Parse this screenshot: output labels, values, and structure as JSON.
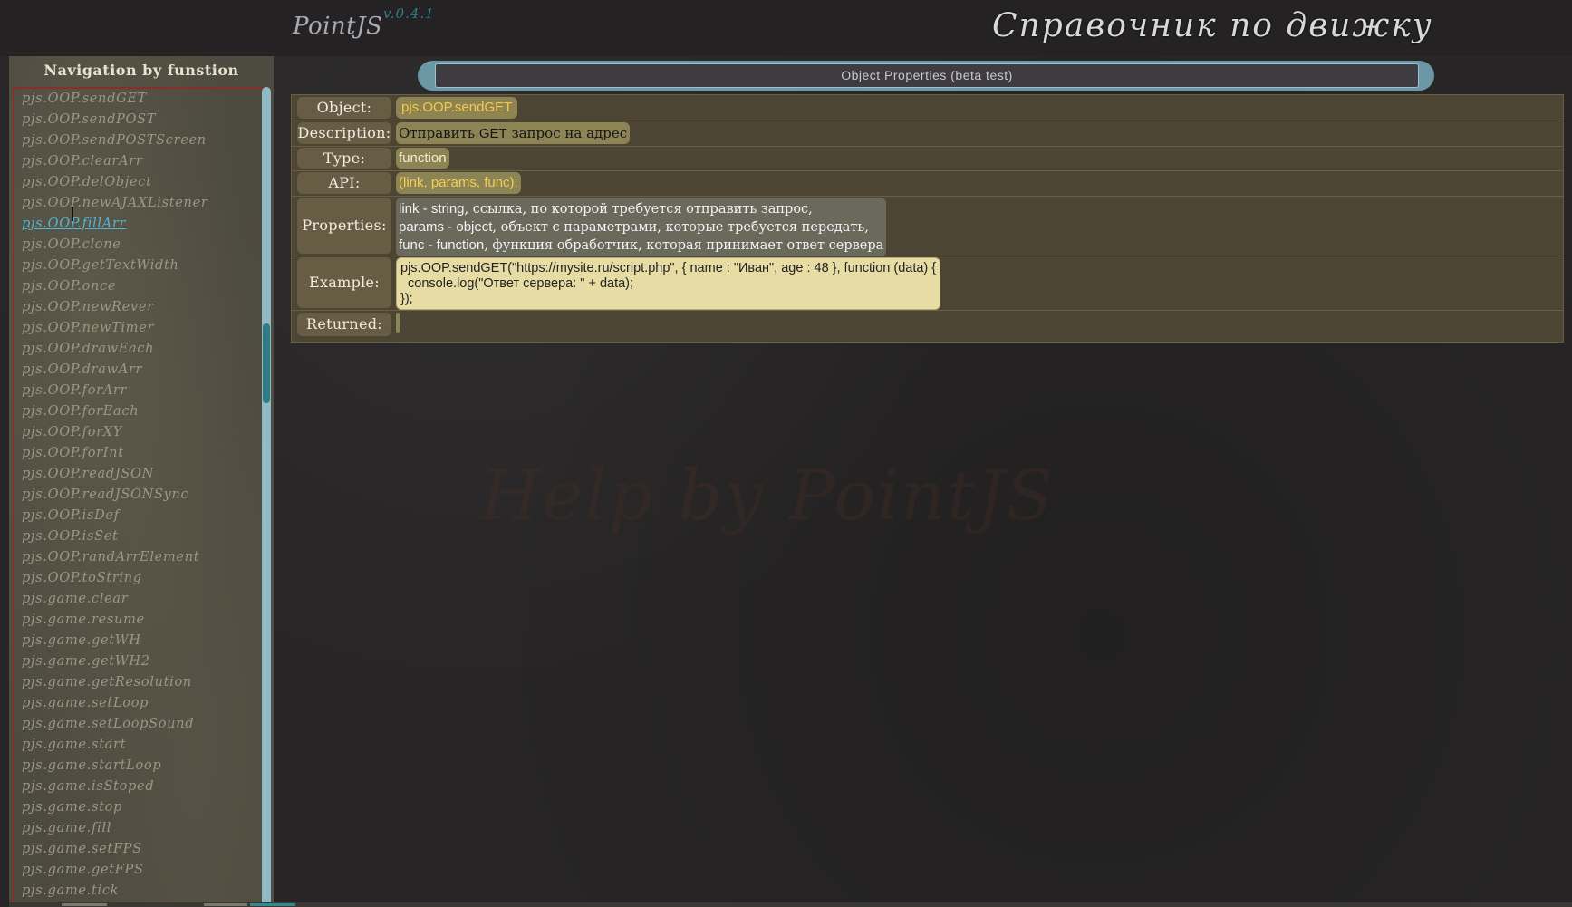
{
  "header": {
    "logo": "PointJS",
    "version": "v.0.4.1",
    "title": "Справочник по движку"
  },
  "sidebar": {
    "title": "Navigation by funstion",
    "items": [
      {
        "label": "pjs.OOP.sendGET"
      },
      {
        "label": "pjs.OOP.sendPOST"
      },
      {
        "label": "pjs.OOP.sendPOSTScreen"
      },
      {
        "label": "pjs.OOP.clearArr"
      },
      {
        "label": "pjs.OOP.delObject"
      },
      {
        "label": "pjs.OOP.newAJAXListener"
      },
      {
        "label": "pjs.OOP.fillArr"
      },
      {
        "label": "pjs.OOP.clone"
      },
      {
        "label": "pjs.OOP.getTextWidth"
      },
      {
        "label": "pjs.OOP.once"
      },
      {
        "label": "pjs.OOP.newRever"
      },
      {
        "label": "pjs.OOP.newTimer"
      },
      {
        "label": "pjs.OOP.drawEach"
      },
      {
        "label": "pjs.OOP.drawArr"
      },
      {
        "label": "pjs.OOP.forArr"
      },
      {
        "label": "pjs.OOP.forEach"
      },
      {
        "label": "pjs.OOP.forXY"
      },
      {
        "label": "pjs.OOP.forInt"
      },
      {
        "label": "pjs.OOP.readJSON"
      },
      {
        "label": "pjs.OOP.readJSONSync"
      },
      {
        "label": "pjs.OOP.isDef"
      },
      {
        "label": "pjs.OOP.isSet"
      },
      {
        "label": "pjs.OOP.randArrElement"
      },
      {
        "label": "pjs.OOP.toString"
      },
      {
        "label": "pjs.game.clear"
      },
      {
        "label": "pjs.game.resume"
      },
      {
        "label": "pjs.game.getWH"
      },
      {
        "label": "pjs.game.getWH2"
      },
      {
        "label": "pjs.game.getResolution"
      },
      {
        "label": "pjs.game.setLoop"
      },
      {
        "label": "pjs.game.setLoopSound"
      },
      {
        "label": "pjs.game.start"
      },
      {
        "label": "pjs.game.startLoop"
      },
      {
        "label": "pjs.game.isStoped"
      },
      {
        "label": "pjs.game.stop"
      },
      {
        "label": "pjs.game.fill"
      },
      {
        "label": "pjs.game.setFPS"
      },
      {
        "label": "pjs.game.getFPS"
      },
      {
        "label": "pjs.game.tick"
      }
    ],
    "active_index": 6
  },
  "panel": {
    "title": "Object Properties (beta test)"
  },
  "properties": {
    "object_label": "Object:",
    "object_value": "pjs.OOP.sendGET",
    "description_label": "Description:",
    "description_value_prefix": "Отправить ",
    "description_value_keyword": "GET",
    "description_value_suffix": " запрос на адрес",
    "type_label": "Type:",
    "type_value": "function",
    "api_label": "API:",
    "api_value": "(link, params, func);",
    "properties_label": "Properties:",
    "params": [
      {
        "name": "link - string",
        "desc": ", ссылка, по которой требуется отправить запрос,"
      },
      {
        "name": "params - object",
        "desc": ", объект с параметрами, которые требуется передать,"
      },
      {
        "name": "func - function",
        "desc": ", функция обработчик, которая принимает ответ сервера"
      }
    ],
    "example_label": "Example:",
    "example_lines": [
      "pjs.OOP.sendGET(\"https://mysite.ru/script.php\", { name : \"Иван\", age : 48 }, function (data) {",
      "  console.log(\"Ответ сервера: \" + data);",
      "});"
    ],
    "returned_label": "Returned:",
    "returned_value": ""
  },
  "watermark": "Help by PointJS",
  "colors": {
    "accent_teal": "#6c98a6",
    "active_link": "#4fb6d6",
    "object_text": "#f4c94d"
  }
}
